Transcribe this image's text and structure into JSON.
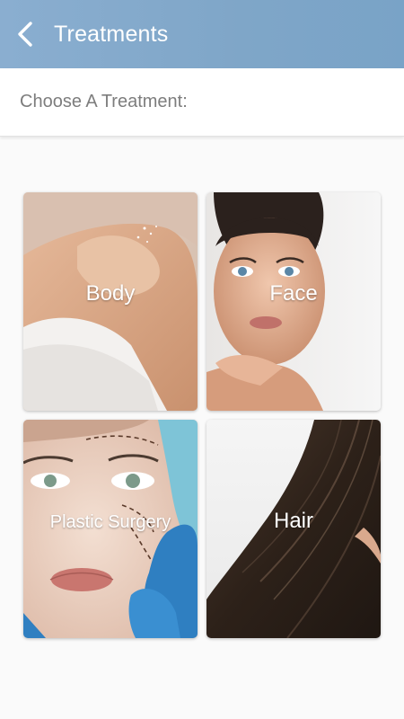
{
  "header": {
    "title": "Treatments",
    "back_icon": "chevron-left-icon",
    "background": "#7fa6c8"
  },
  "subheader": {
    "prompt": "Choose A Treatment:"
  },
  "treatments": [
    {
      "label": "Body"
    },
    {
      "label": "Face"
    },
    {
      "label": "Plastic Surgery"
    },
    {
      "label": "Hair"
    }
  ]
}
